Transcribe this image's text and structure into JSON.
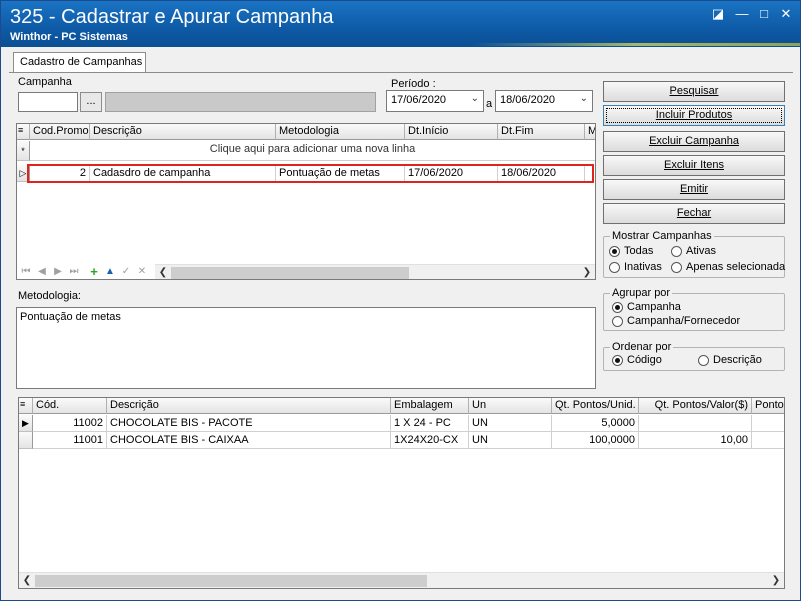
{
  "window": {
    "title": "325 - Cadastrar e Apurar Campanha",
    "subtitle": "Winthor - PC Sistemas",
    "controls": {
      "restore": "◪",
      "minimize": "—",
      "maximize": "□",
      "close": "✕"
    }
  },
  "tabs": [
    {
      "label": "Cadastro de Campanhas",
      "active": true
    }
  ],
  "campanha": {
    "label": "Campanha",
    "code_value": "",
    "browse_label": "...",
    "name_value": ""
  },
  "periodo": {
    "label": "Período :",
    "start": "17/06/2020",
    "separator": "a",
    "end": "18/06/2020",
    "dropdown_icon": "chevron-down-icon"
  },
  "actions": {
    "pesquisar": "Pesquisar",
    "incluir_produtos": "Incluir Produtos",
    "excluir_campanha": "Excluir Campanha",
    "excluir_itens": "Excluir Itens",
    "emitir": "Emitir",
    "fechar": "Fechar"
  },
  "mostrar_campanhas": {
    "title": "Mostrar Campanhas",
    "options": [
      "Todas",
      "Ativas",
      "Inativas",
      "Apenas selecionada"
    ],
    "selected": "Todas"
  },
  "agrupar_por": {
    "title": "Agrupar por",
    "options": [
      "Campanha",
      "Campanha/Fornecedor"
    ],
    "selected": "Campanha"
  },
  "ordenar_por": {
    "title": "Ordenar por",
    "options": [
      "Código",
      "Descrição"
    ],
    "selected": "Código"
  },
  "campaign_grid": {
    "columns": [
      "Cod.Promoç",
      "Descrição",
      "Metodologia",
      "Dt.Início",
      "Dt.Fim",
      "M"
    ],
    "new_row_text": "Clique aqui para adicionar uma nova linha",
    "new_row_marker": "*",
    "rows": [
      {
        "marker": "▷",
        "cod": "2",
        "descricao": "Cadasdro de campanha",
        "metodologia": "Pontuação de metas",
        "dt_inicio": "17/06/2020",
        "dt_fim": "18/06/2020"
      }
    ],
    "highlight_color": "#e0241c"
  },
  "metodologia": {
    "label": "Metodologia:",
    "value": "Pontuação de metas"
  },
  "products_grid": {
    "columns": [
      "Cód.",
      "Descrição",
      "Embalagem",
      "Un",
      "Qt. Pontos/Unid.",
      "Qt. Pontos/Valor($)",
      "Pontos"
    ],
    "rows": [
      {
        "marker": "▶",
        "cod": "11002",
        "descricao": "CHOCOLATE BIS - PACOTE",
        "embalagem": "1 X 24 - PC",
        "un": "UN",
        "qt_pontos_unid": "5,0000",
        "qt_pontos_valor": "",
        "pontos": ""
      },
      {
        "marker": "",
        "cod": "11001",
        "descricao": "CHOCOLATE BIS  - CAIXAA",
        "embalagem": "1X24X20-CX",
        "un": "UN",
        "qt_pontos_unid": "100,0000",
        "qt_pontos_valor": "10,00",
        "pontos": ""
      }
    ]
  },
  "colors": {
    "titlebar": "#0e5aa6",
    "window_bg": "#f0f0f0",
    "nav_add": "#2aa52a",
    "nav_up": "#1a5fb4"
  }
}
